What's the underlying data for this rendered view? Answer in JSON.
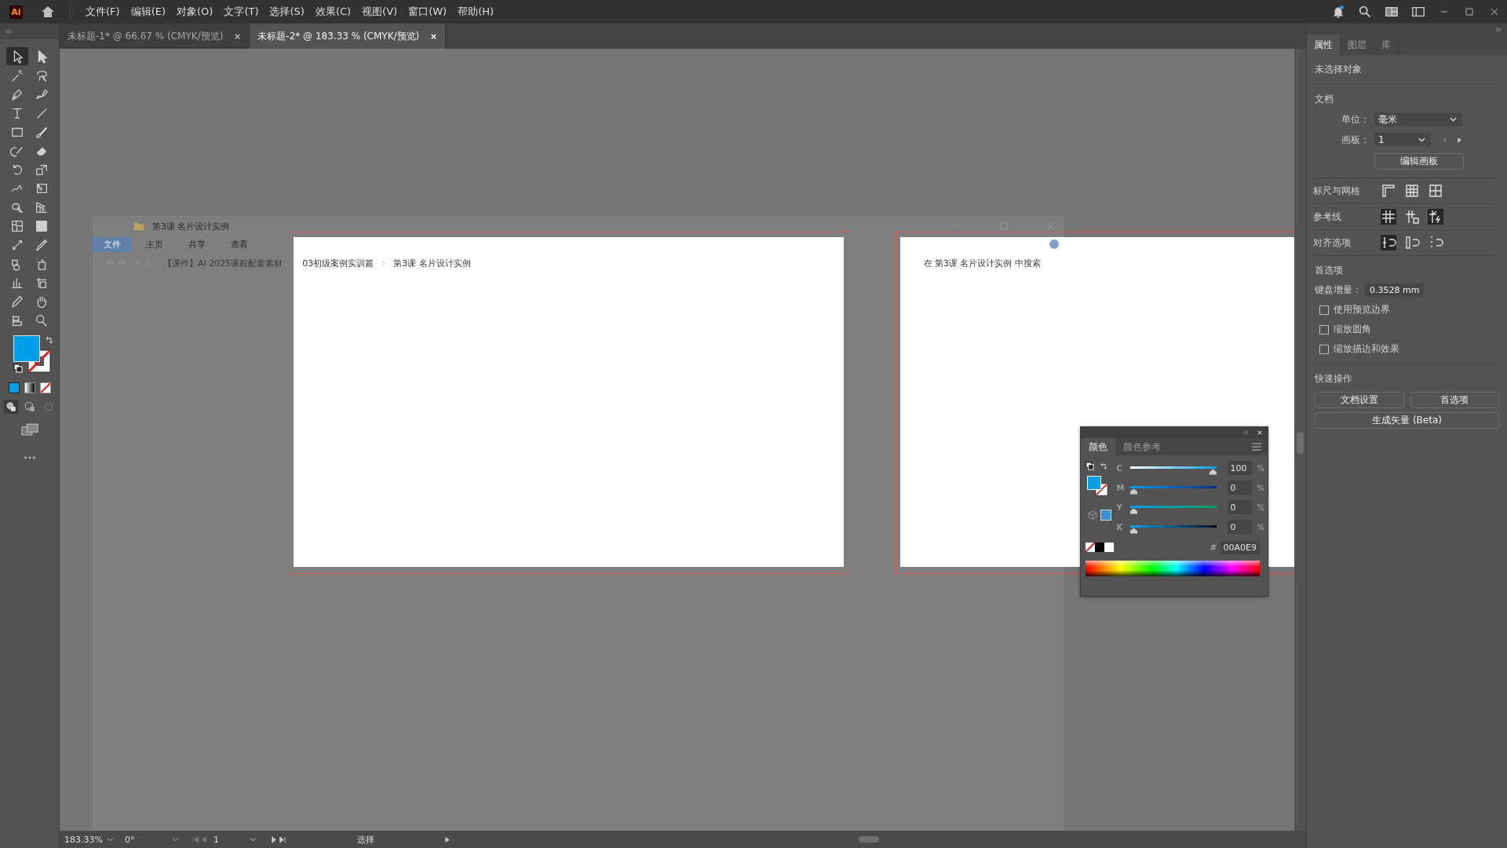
{
  "app": {
    "logo": "Ai",
    "menu": [
      "文件(F)",
      "编辑(E)",
      "对象(O)",
      "文字(T)",
      "选择(S)",
      "效果(C)",
      "视图(V)",
      "窗口(W)",
      "帮助(H)"
    ]
  },
  "document_tabs": [
    {
      "title": "未标题-1* @ 66.67 % (CMYK/预览)",
      "selected": false
    },
    {
      "title": "未标题-2* @ 183.33 % (CMYK/预览)",
      "selected": true
    }
  ],
  "tools": [
    {
      "kind": "selection",
      "selected": true
    },
    {
      "kind": "direct-selection",
      "selected": false
    },
    {
      "kind": "magic-wand",
      "selected": false
    },
    {
      "kind": "lasso",
      "selected": false
    },
    {
      "kind": "pen",
      "selected": false
    },
    {
      "kind": "curvature",
      "selected": false
    },
    {
      "kind": "type",
      "selected": false
    },
    {
      "kind": "line",
      "selected": false
    },
    {
      "kind": "rectangle",
      "selected": false
    },
    {
      "kind": "paintbrush",
      "selected": false
    },
    {
      "kind": "shaper",
      "selected": false
    },
    {
      "kind": "eraser",
      "selected": false
    },
    {
      "kind": "rotate",
      "selected": false
    },
    {
      "kind": "scale",
      "selected": false
    },
    {
      "kind": "puppet-warp",
      "selected": false
    },
    {
      "kind": "free-transform",
      "selected": false
    },
    {
      "kind": "shape-builder",
      "selected": false
    },
    {
      "kind": "perspective",
      "selected": false
    },
    {
      "kind": "mesh",
      "selected": false
    },
    {
      "kind": "gradient",
      "selected": false
    },
    {
      "kind": "width",
      "selected": false
    },
    {
      "kind": "eyedropper",
      "selected": false
    },
    {
      "kind": "blend",
      "selected": false
    },
    {
      "kind": "symbol-sprayer",
      "selected": false
    },
    {
      "kind": "graph",
      "selected": false
    },
    {
      "kind": "artboard",
      "selected": false
    },
    {
      "kind": "pencil",
      "selected": false
    },
    {
      "kind": "hand",
      "selected": false
    },
    {
      "kind": "flag",
      "selected": false
    },
    {
      "kind": "zoom",
      "selected": false
    }
  ],
  "explorer_overlay": {
    "title": "第3课 名片设计实例",
    "ribbon_tabs": [
      {
        "label": "文件",
        "selected": true
      },
      {
        "label": "主页",
        "selected": false
      },
      {
        "label": "共享",
        "selected": false
      },
      {
        "label": "查看",
        "selected": false
      }
    ],
    "path": [
      "【课件】AI 2025课程配套素材",
      "03初级案例实训篇",
      "第3课 名片设计实例"
    ],
    "search_placeholder": "在 第3课 名片设计实例 中搜索"
  },
  "color_panel": {
    "tabs": [
      {
        "label": "颜色",
        "selected": true
      },
      {
        "label": "颜色参考",
        "selected": false
      }
    ],
    "channels": [
      {
        "name": "C",
        "level": 1,
        "value": "100",
        "unit": "%"
      },
      {
        "name": "M",
        "level": 0,
        "value": "0",
        "unit": "%"
      },
      {
        "name": "Y",
        "level": 0,
        "value": "0",
        "unit": "%"
      },
      {
        "name": "K",
        "level": 0,
        "value": "0",
        "unit": "%"
      }
    ],
    "hash": "#",
    "hex": "00A0E9"
  },
  "properties_panel": {
    "tabs": [
      {
        "label": "属性",
        "selected": true
      },
      {
        "label": "图层",
        "selected": false
      },
      {
        "label": "库",
        "selected": false
      }
    ],
    "selection": "未选择对象",
    "document": {
      "heading": "文档",
      "unit_label": "单位：",
      "unit": "毫米",
      "artboard_label": "画板：",
      "artboard": "1",
      "edit_button": "编辑画板"
    },
    "rows": [
      {
        "label": "标尺与网格",
        "buttons": [
          {
            "kind": "ruler",
            "on": false
          },
          {
            "kind": "grid",
            "on": false
          },
          {
            "kind": "transparency-grid",
            "on": false
          }
        ]
      },
      {
        "label": "参考线",
        "buttons": [
          {
            "kind": "guides",
            "on": true
          },
          {
            "kind": "lock-guides",
            "on": false
          },
          {
            "kind": "smart-guides",
            "on": true
          }
        ]
      },
      {
        "label": "对齐选项",
        "buttons": [
          {
            "kind": "snap-point",
            "on": true
          },
          {
            "kind": "snap-pixel",
            "on": false
          },
          {
            "kind": "snap-glyph",
            "on": false
          }
        ]
      }
    ],
    "preferences": {
      "heading": "首选项",
      "increment_label": "键盘增量：",
      "increment": "0.3528 mm",
      "options": [
        {
          "label": "使用预览边界",
          "checked": false
        },
        {
          "label": "缩放圆角",
          "checked": false
        },
        {
          "label": "缩放描边和效果",
          "checked": false
        }
      ]
    },
    "quick_actions": {
      "heading": "快速操作",
      "buttons": [
        "文档设置",
        "首选项",
        "生成矢量 (Beta)"
      ]
    }
  },
  "status_bar": {
    "zoom": "183.33%",
    "rotation": "0°",
    "artboard": "1",
    "tool": "选择"
  }
}
